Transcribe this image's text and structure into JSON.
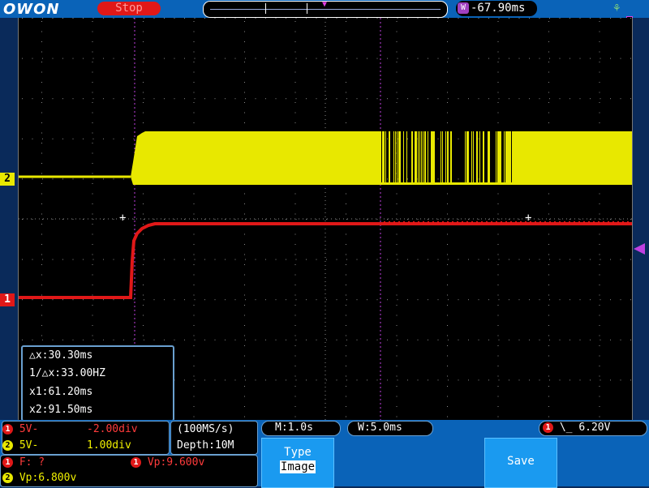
{
  "brand": {
    "logo_text": "OWON"
  },
  "status": {
    "run_state": "Stop"
  },
  "trigger": {
    "position": "-67.90ms",
    "position_badge": "W",
    "level": "6.20V",
    "source_badge": "1",
    "slope_symbol": "\\_"
  },
  "channels": {
    "ch1": {
      "marker": "1",
      "scale": "5V-",
      "offset": "-2.00div",
      "vp": "Vp:9.600v",
      "freq": "F:  ?"
    },
    "ch2": {
      "marker": "2",
      "scale": "5V-",
      "offset": "1.00div",
      "vp": "Vp:6.800v"
    }
  },
  "cursors": {
    "delta_x": "△x:30.30ms",
    "inv_delta_x": "1/△x:33.00HZ",
    "x1": "x1:61.20ms",
    "x2": "x2:91.50ms"
  },
  "acquisition": {
    "sample_rate": "(100MS/s)",
    "depth": "Depth:10M"
  },
  "timebase": {
    "main": "M:1.0s",
    "window": "W:5.0ms"
  },
  "menu": {
    "type_label": "Type",
    "type_value": "Image",
    "save_label": "Save"
  },
  "colors": {
    "ch1": "#e01818",
    "ch2": "#e8e800",
    "trigger": "#c040e0",
    "background": "#0a63b8"
  },
  "icons": {
    "usb": "usb-icon",
    "trigger_level": "trigger-level-arrow-icon"
  }
}
